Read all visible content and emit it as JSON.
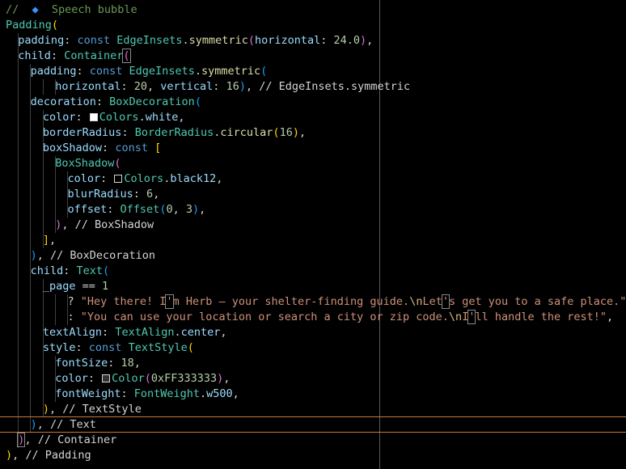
{
  "theme": {
    "background": "#000000",
    "comment": "#6a9955",
    "class": "#4ec9b0",
    "property": "#9cdcfe",
    "keyword": "#569cd6",
    "function": "#dcdcaa",
    "number": "#b5cea8",
    "string": "#ce9178",
    "escape": "#d7ba7d",
    "plain": "#d4d4d4",
    "bracket_gold": "#ffd700",
    "bracket_pink": "#da70d6",
    "bracket_blue": "#179fff",
    "current_line_border": "#c77b3a"
  },
  "lines": [
    {
      "indent": 0,
      "tokens": [
        {
          "t": "//  ",
          "c": "comment"
        },
        {
          "t": "◆",
          "c": "diamond"
        },
        {
          "t": "  Speech bubble",
          "c": "comment"
        }
      ]
    },
    {
      "indent": 0,
      "tokens": [
        {
          "t": "Padding",
          "c": "class"
        },
        {
          "t": "(",
          "c": "b1"
        }
      ]
    },
    {
      "indent": 1,
      "tokens": [
        {
          "t": "padding",
          "c": "prop"
        },
        {
          "t": ": ",
          "c": "plain"
        },
        {
          "t": "const ",
          "c": "key"
        },
        {
          "t": "EdgeInsets",
          "c": "class"
        },
        {
          "t": ".",
          "c": "plain"
        },
        {
          "t": "symmetric",
          "c": "fn"
        },
        {
          "t": "(",
          "c": "b2"
        },
        {
          "t": "horizontal",
          "c": "prop"
        },
        {
          "t": ": ",
          "c": "plain"
        },
        {
          "t": "24.0",
          "c": "num"
        },
        {
          "t": ")",
          "c": "b2"
        },
        {
          "t": ",",
          "c": "plain"
        }
      ]
    },
    {
      "indent": 1,
      "tokens": [
        {
          "t": "child",
          "c": "prop"
        },
        {
          "t": ": ",
          "c": "plain"
        },
        {
          "t": "Container",
          "c": "class"
        },
        {
          "t": "(",
          "c": "b2",
          "boxed": true
        }
      ]
    },
    {
      "indent": 2,
      "tokens": [
        {
          "t": "padding",
          "c": "prop"
        },
        {
          "t": ": ",
          "c": "plain"
        },
        {
          "t": "const ",
          "c": "key"
        },
        {
          "t": "EdgeInsets",
          "c": "class"
        },
        {
          "t": ".",
          "c": "plain"
        },
        {
          "t": "symmetric",
          "c": "fn"
        },
        {
          "t": "(",
          "c": "b3"
        }
      ]
    },
    {
      "indent": 4,
      "tokens": [
        {
          "t": "horizontal",
          "c": "prop"
        },
        {
          "t": ": ",
          "c": "plain"
        },
        {
          "t": "20",
          "c": "num"
        },
        {
          "t": ", ",
          "c": "plain"
        },
        {
          "t": "vertical",
          "c": "prop"
        },
        {
          "t": ": ",
          "c": "plain"
        },
        {
          "t": "16",
          "c": "num"
        },
        {
          "t": ")",
          "c": "b3"
        },
        {
          "t": ", // EdgeInsets.symmetric",
          "c": "plain"
        }
      ]
    },
    {
      "indent": 2,
      "tokens": [
        {
          "t": "decoration",
          "c": "prop"
        },
        {
          "t": ": ",
          "c": "plain"
        },
        {
          "t": "BoxDecoration",
          "c": "class"
        },
        {
          "t": "(",
          "c": "b3"
        }
      ]
    },
    {
      "indent": 3,
      "tokens": [
        {
          "t": "color",
          "c": "prop"
        },
        {
          "t": ": ",
          "c": "plain"
        },
        {
          "swatch": "#ffffff"
        },
        {
          "t": "Colors",
          "c": "class"
        },
        {
          "t": ".",
          "c": "plain"
        },
        {
          "t": "white",
          "c": "prop"
        },
        {
          "t": ",",
          "c": "plain"
        }
      ]
    },
    {
      "indent": 3,
      "tokens": [
        {
          "t": "borderRadius",
          "c": "prop"
        },
        {
          "t": ": ",
          "c": "plain"
        },
        {
          "t": "BorderRadius",
          "c": "class"
        },
        {
          "t": ".",
          "c": "plain"
        },
        {
          "t": "circular",
          "c": "fn"
        },
        {
          "t": "(",
          "c": "b1"
        },
        {
          "t": "16",
          "c": "num"
        },
        {
          "t": ")",
          "c": "b1"
        },
        {
          "t": ",",
          "c": "plain"
        }
      ]
    },
    {
      "indent": 3,
      "tokens": [
        {
          "t": "boxShadow",
          "c": "prop"
        },
        {
          "t": ": ",
          "c": "plain"
        },
        {
          "t": "const ",
          "c": "key"
        },
        {
          "t": "[",
          "c": "b1"
        }
      ]
    },
    {
      "indent": 4,
      "tokens": [
        {
          "t": "BoxShadow",
          "c": "class"
        },
        {
          "t": "(",
          "c": "b2"
        }
      ]
    },
    {
      "indent": 5,
      "tokens": [
        {
          "t": "color",
          "c": "prop"
        },
        {
          "t": ": ",
          "c": "plain"
        },
        {
          "swatch": "#000000"
        },
        {
          "t": "Colors",
          "c": "class"
        },
        {
          "t": ".",
          "c": "plain"
        },
        {
          "t": "black12",
          "c": "prop"
        },
        {
          "t": ",",
          "c": "plain"
        }
      ]
    },
    {
      "indent": 5,
      "tokens": [
        {
          "t": "blurRadius",
          "c": "prop"
        },
        {
          "t": ": ",
          "c": "plain"
        },
        {
          "t": "6",
          "c": "num"
        },
        {
          "t": ",",
          "c": "plain"
        }
      ]
    },
    {
      "indent": 5,
      "tokens": [
        {
          "t": "offset",
          "c": "prop"
        },
        {
          "t": ": ",
          "c": "plain"
        },
        {
          "t": "Offset",
          "c": "class"
        },
        {
          "t": "(",
          "c": "b3"
        },
        {
          "t": "0",
          "c": "num"
        },
        {
          "t": ", ",
          "c": "plain"
        },
        {
          "t": "3",
          "c": "num"
        },
        {
          "t": ")",
          "c": "b3"
        },
        {
          "t": ",",
          "c": "plain"
        }
      ]
    },
    {
      "indent": 4,
      "tokens": [
        {
          "t": ")",
          "c": "b2"
        },
        {
          "t": ", // BoxShadow",
          "c": "plain"
        }
      ]
    },
    {
      "indent": 3,
      "tokens": [
        {
          "t": "]",
          "c": "b1"
        },
        {
          "t": ",",
          "c": "plain"
        }
      ]
    },
    {
      "indent": 2,
      "tokens": [
        {
          "t": ")",
          "c": "b3"
        },
        {
          "t": ", // BoxDecoration",
          "c": "plain"
        }
      ]
    },
    {
      "indent": 2,
      "tokens": [
        {
          "t": "child",
          "c": "prop"
        },
        {
          "t": ": ",
          "c": "plain"
        },
        {
          "t": "Text",
          "c": "class"
        },
        {
          "t": "(",
          "c": "b3"
        }
      ]
    },
    {
      "indent": 3,
      "tokens": [
        {
          "t": "_page",
          "c": "prop"
        },
        {
          "t": " == ",
          "c": "plain"
        },
        {
          "t": "1",
          "c": "num"
        }
      ]
    },
    {
      "indent": 5,
      "tokens": [
        {
          "t": "? ",
          "c": "plain"
        },
        {
          "t": "\"Hey there! I",
          "c": "str"
        },
        {
          "t": "'",
          "c": "str",
          "boxed": true
        },
        {
          "t": "m Herb — your shelter-finding guide.",
          "c": "str"
        },
        {
          "t": "\\n",
          "c": "esc"
        },
        {
          "t": "Let",
          "c": "str"
        },
        {
          "t": "'",
          "c": "str",
          "boxed": true
        },
        {
          "t": "s get you to a safe place.\"",
          "c": "str"
        }
      ]
    },
    {
      "indent": 5,
      "tokens": [
        {
          "t": ": ",
          "c": "plain"
        },
        {
          "t": "\"You can use your location or search a city or zip code.",
          "c": "str"
        },
        {
          "t": "\\n",
          "c": "esc"
        },
        {
          "t": "I",
          "c": "str"
        },
        {
          "t": "'",
          "c": "str",
          "boxed": true
        },
        {
          "t": "ll handle the rest!\"",
          "c": "str"
        },
        {
          "t": ",",
          "c": "plain"
        }
      ]
    },
    {
      "indent": 3,
      "tokens": [
        {
          "t": "textAlign",
          "c": "prop"
        },
        {
          "t": ": ",
          "c": "plain"
        },
        {
          "t": "TextAlign",
          "c": "class"
        },
        {
          "t": ".",
          "c": "plain"
        },
        {
          "t": "center",
          "c": "prop"
        },
        {
          "t": ",",
          "c": "plain"
        }
      ]
    },
    {
      "indent": 3,
      "tokens": [
        {
          "t": "style",
          "c": "prop"
        },
        {
          "t": ": ",
          "c": "plain"
        },
        {
          "t": "const ",
          "c": "key"
        },
        {
          "t": "TextStyle",
          "c": "class"
        },
        {
          "t": "(",
          "c": "b1"
        }
      ]
    },
    {
      "indent": 4,
      "tokens": [
        {
          "t": "fontSize",
          "c": "prop"
        },
        {
          "t": ": ",
          "c": "plain"
        },
        {
          "t": "18",
          "c": "num"
        },
        {
          "t": ",",
          "c": "plain"
        }
      ]
    },
    {
      "indent": 4,
      "tokens": [
        {
          "t": "color",
          "c": "prop"
        },
        {
          "t": ": ",
          "c": "plain"
        },
        {
          "swatch": "#333333"
        },
        {
          "t": "Color",
          "c": "class"
        },
        {
          "t": "(",
          "c": "b2"
        },
        {
          "t": "0xFF333333",
          "c": "num"
        },
        {
          "t": ")",
          "c": "b2"
        },
        {
          "t": ",",
          "c": "plain"
        }
      ]
    },
    {
      "indent": 4,
      "tokens": [
        {
          "t": "fontWeight",
          "c": "prop"
        },
        {
          "t": ": ",
          "c": "plain"
        },
        {
          "t": "FontWeight",
          "c": "class"
        },
        {
          "t": ".",
          "c": "plain"
        },
        {
          "t": "w500",
          "c": "prop"
        },
        {
          "t": ",",
          "c": "plain"
        }
      ]
    },
    {
      "indent": 3,
      "tokens": [
        {
          "t": ")",
          "c": "b1"
        },
        {
          "t": ", // TextStyle",
          "c": "plain"
        }
      ]
    },
    {
      "indent": 2,
      "tokens": [
        {
          "t": ")",
          "c": "b3"
        },
        {
          "t": ", // Text",
          "c": "plain"
        }
      ]
    },
    {
      "indent": 1,
      "tokens": [
        {
          "t": ")",
          "c": "b2",
          "boxed": true
        },
        {
          "t": ", // Container",
          "c": "plain"
        }
      ]
    },
    {
      "indent": 0,
      "tokens": [
        {
          "t": ")",
          "c": "b1"
        },
        {
          "t": ", // Padding",
          "c": "plain"
        }
      ]
    }
  ]
}
